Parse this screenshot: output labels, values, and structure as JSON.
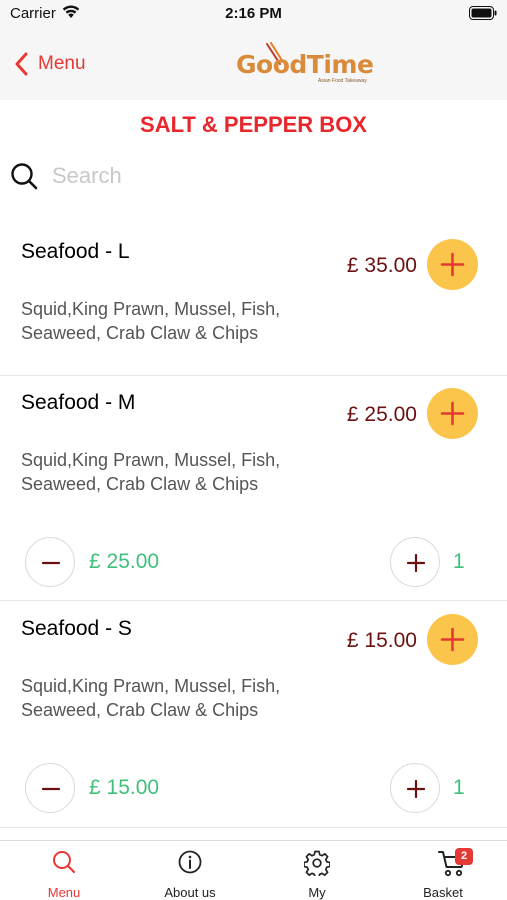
{
  "status_bar": {
    "carrier": "Carrier",
    "time": "2:16 PM"
  },
  "nav": {
    "back_label": "Menu",
    "logo_text": "GoodTime",
    "logo_tagline": "Asian Food Takeaway"
  },
  "page": {
    "title": "SALT & PEPPER BOX"
  },
  "search": {
    "placeholder": "Search",
    "value": ""
  },
  "items": [
    {
      "name": "Seafood - L",
      "price": "£ 35.00",
      "description": "Squid,King Prawn, Mussel, Fish, Seaweed, Crab Claw & Chips",
      "in_basket": false
    },
    {
      "name": "Seafood - M",
      "price": "£ 25.00",
      "description": "Squid,King Prawn, Mussel, Fish, Seaweed, Crab Claw & Chips",
      "in_basket": true,
      "quantity_total": "£ 25.00",
      "quantity": "1"
    },
    {
      "name": "Seafood - S",
      "price": "£ 15.00",
      "description": "Squid,King Prawn, Mussel, Fish, Seaweed, Crab Claw & Chips",
      "in_basket": true,
      "quantity_total": "£ 15.00",
      "quantity": "1"
    }
  ],
  "tab_bar": {
    "tabs": [
      {
        "label": "Menu",
        "icon": "search-icon",
        "active": true
      },
      {
        "label": "About us",
        "icon": "info-icon",
        "active": false
      },
      {
        "label": "My",
        "icon": "gear-icon",
        "active": false
      },
      {
        "label": "Basket",
        "icon": "cart-icon",
        "active": false,
        "badge": "2"
      }
    ]
  },
  "colors": {
    "accent_red": "#e53935",
    "title_red": "#e8262b",
    "price_maroon": "#6b1111",
    "add_button_yellow": "#fbc54b",
    "quantity_green": "#3fbf7a"
  }
}
